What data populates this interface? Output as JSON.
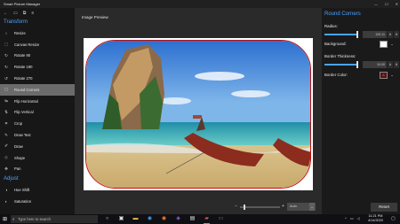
{
  "window": {
    "title": "Smart Picture Manager",
    "controls": [
      "—",
      "☐",
      "✕"
    ]
  },
  "sidebar": {
    "toolbar_icons": [
      "back-arrow-icon",
      "document-icon",
      "copy-icon",
      "menu-icon"
    ],
    "sections": [
      {
        "title": "Transform",
        "items": [
          {
            "icon": "↕",
            "label": "Resize"
          },
          {
            "icon": "⬚",
            "label": "Canvas Resize"
          },
          {
            "icon": "↻",
            "label": "Rotate 90"
          },
          {
            "icon": "↻",
            "label": "Rotate 180"
          },
          {
            "icon": "↺",
            "label": "Rotate 270"
          },
          {
            "icon": "▢",
            "label": "Round Corners",
            "active": true
          },
          {
            "icon": "⇋",
            "label": "Flip Horizontal"
          },
          {
            "icon": "⇅",
            "label": "Flip Vertical"
          },
          {
            "icon": "⌗",
            "label": "Crop"
          },
          {
            "icon": "✎",
            "label": "Draw Text"
          },
          {
            "icon": "✐",
            "label": "Draw"
          },
          {
            "icon": "◇",
            "label": "Shape"
          },
          {
            "icon": "✥",
            "label": "Pan"
          }
        ]
      },
      {
        "title": "Adjust",
        "items": [
          {
            "icon": "◑",
            "label": "Hue Shift"
          },
          {
            "icon": "◐",
            "label": "Saturation"
          }
        ]
      }
    ]
  },
  "preview": {
    "label": "Image Preview",
    "zoom_value": "Auto",
    "zoom_minus": "−",
    "zoom_plus": "+",
    "zoom_chevron": "⌄"
  },
  "round_corners_panel": {
    "title": "Round Corners",
    "radius_label": "Radius:",
    "radius_value": "100.11",
    "background_label": "Background:",
    "background_color": "#FFFFFF",
    "border_thickness_label": "Border Thickness:",
    "border_thickness_value": "10.00",
    "border_color_label": "Border Color:",
    "border_color": "#C01010",
    "reset_label": "Reset",
    "spin_up": "∧",
    "spin_down": "∨",
    "swatch_glyph": "A",
    "swatch_arrow": "⌄"
  },
  "taskbar": {
    "search_placeholder": "Type here to search",
    "pinned_icons": [
      "task-view-icon",
      "widgets-icon",
      "file-explorer-icon",
      "edge-icon",
      "firefox-icon",
      "visual-studio-icon",
      "store-icon",
      "photos-icon",
      "app-icon"
    ],
    "time": "11:21 PM",
    "date": "4/14/2020"
  },
  "colors": {
    "accent": "#4AA3FF",
    "active_item": "#6B6B6B",
    "border_red": "#C01010"
  }
}
